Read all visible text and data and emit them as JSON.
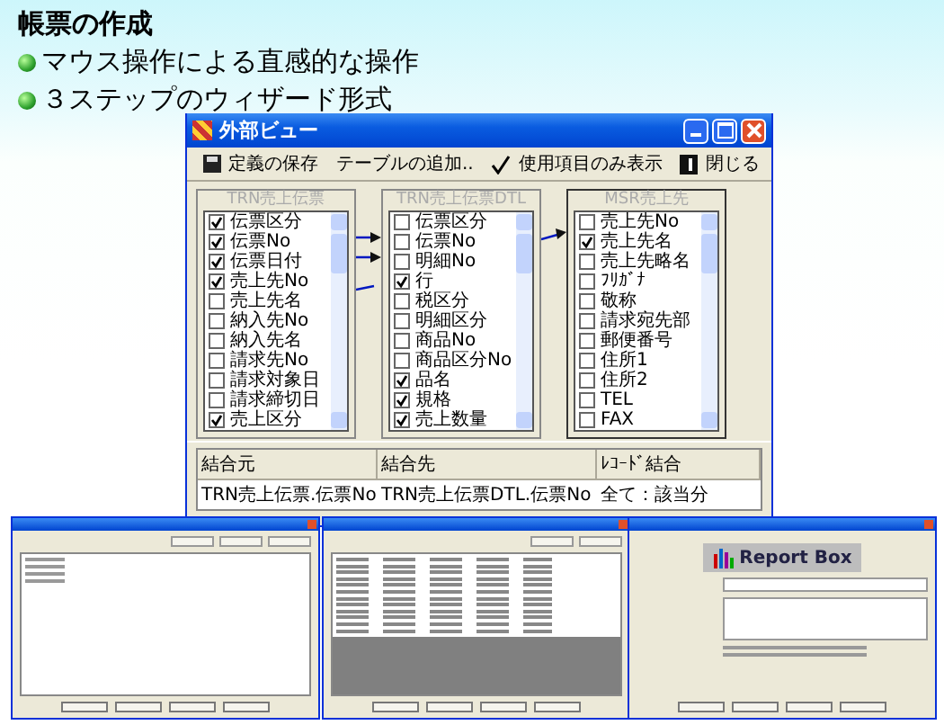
{
  "slide": {
    "heading": "帳票の作成",
    "bullets": [
      "マウス操作による直感的な操作",
      "３ステップのウィザード形式"
    ]
  },
  "window": {
    "title": "外部ビュー",
    "toolbar": [
      {
        "label": "定義の保存",
        "kind": "save"
      },
      {
        "label": "テーブルの追加..",
        "kind": "plain"
      },
      {
        "label": "使用項目のみ表示",
        "kind": "check"
      },
      {
        "label": "閉じる",
        "kind": "exit"
      }
    ],
    "tables": [
      {
        "name": "TRN売上伝票",
        "fields": [
          {
            "label": "伝票区分",
            "checked": true
          },
          {
            "label": "伝票No",
            "checked": true
          },
          {
            "label": "伝票日付",
            "checked": true
          },
          {
            "label": "売上先No",
            "checked": true
          },
          {
            "label": "売上先名",
            "checked": false
          },
          {
            "label": "納入先No",
            "checked": false
          },
          {
            "label": "納入先名",
            "checked": false
          },
          {
            "label": "請求先No",
            "checked": false
          },
          {
            "label": "請求対象日",
            "checked": false
          },
          {
            "label": "請求締切日",
            "checked": false
          },
          {
            "label": "売上区分",
            "checked": true
          }
        ]
      },
      {
        "name": "TRN売上伝票DTL",
        "fields": [
          {
            "label": "伝票区分",
            "checked": false
          },
          {
            "label": "伝票No",
            "checked": false
          },
          {
            "label": "明細No",
            "checked": false
          },
          {
            "label": "行",
            "checked": true
          },
          {
            "label": "税区分",
            "checked": false
          },
          {
            "label": "明細区分",
            "checked": false
          },
          {
            "label": "商品No",
            "checked": false
          },
          {
            "label": "商品区分No",
            "checked": false
          },
          {
            "label": "品名",
            "checked": true
          },
          {
            "label": "規格",
            "checked": true
          },
          {
            "label": "売上数量",
            "checked": true
          }
        ]
      },
      {
        "name": "MSR売上先",
        "fields": [
          {
            "label": "売上先No",
            "checked": false
          },
          {
            "label": "売上先名",
            "checked": true
          },
          {
            "label": "売上先略名",
            "checked": false
          },
          {
            "label": "ﾌﾘｶﾞﾅ",
            "checked": false
          },
          {
            "label": "敬称",
            "checked": false
          },
          {
            "label": "請求宛先部",
            "checked": false
          },
          {
            "label": "郵便番号",
            "checked": false
          },
          {
            "label": "住所1",
            "checked": false
          },
          {
            "label": "住所2",
            "checked": false
          },
          {
            "label": "TEL",
            "checked": false
          },
          {
            "label": "FAX",
            "checked": false
          }
        ]
      }
    ],
    "joins": {
      "columns": [
        "結合元",
        "結合先",
        "ﾚｺｰﾄﾞ結合"
      ],
      "rows": [
        [
          "TRN売上伝票.伝票No",
          "TRN売上伝票DTL.伝票No",
          "全て：該当分"
        ]
      ]
    }
  },
  "wizards": [
    {
      "kind": "tables"
    },
    {
      "kind": "fields"
    },
    {
      "kind": "title",
      "logo": "Report Box"
    }
  ]
}
